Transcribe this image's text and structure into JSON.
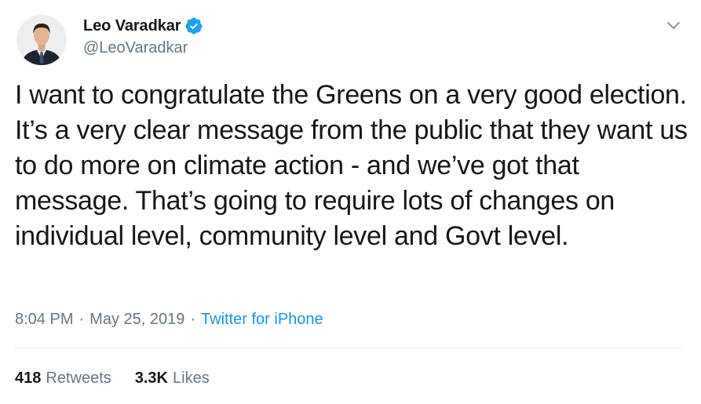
{
  "author": {
    "display_name": "Leo Varadkar",
    "handle": "@LeoVaradkar",
    "verified": true,
    "avatar_icon": "profile-photo"
  },
  "tweet": {
    "text": "I want to congratulate the Greens on a very good election. It’s a very clear message from the public that they want us to do more on climate action - and we’ve got that message. That’s going to require lots of changes on individual level, community level and Govt level.",
    "time": "8:04 PM",
    "separator_1": "·",
    "date": "May 25, 2019",
    "separator_2": "·",
    "source": "Twitter for iPhone"
  },
  "stats": {
    "retweets_count": "418",
    "retweets_label": "Retweets",
    "likes_count": "3.3K",
    "likes_label": "Likes"
  },
  "colors": {
    "text": "#14171a",
    "secondary": "#657786",
    "link": "#1b95e0",
    "verified": "#1da1f2",
    "divider": "#e6ecf0"
  },
  "icons": {
    "verified": "verified-badge-icon",
    "menu": "chevron-down-icon"
  }
}
